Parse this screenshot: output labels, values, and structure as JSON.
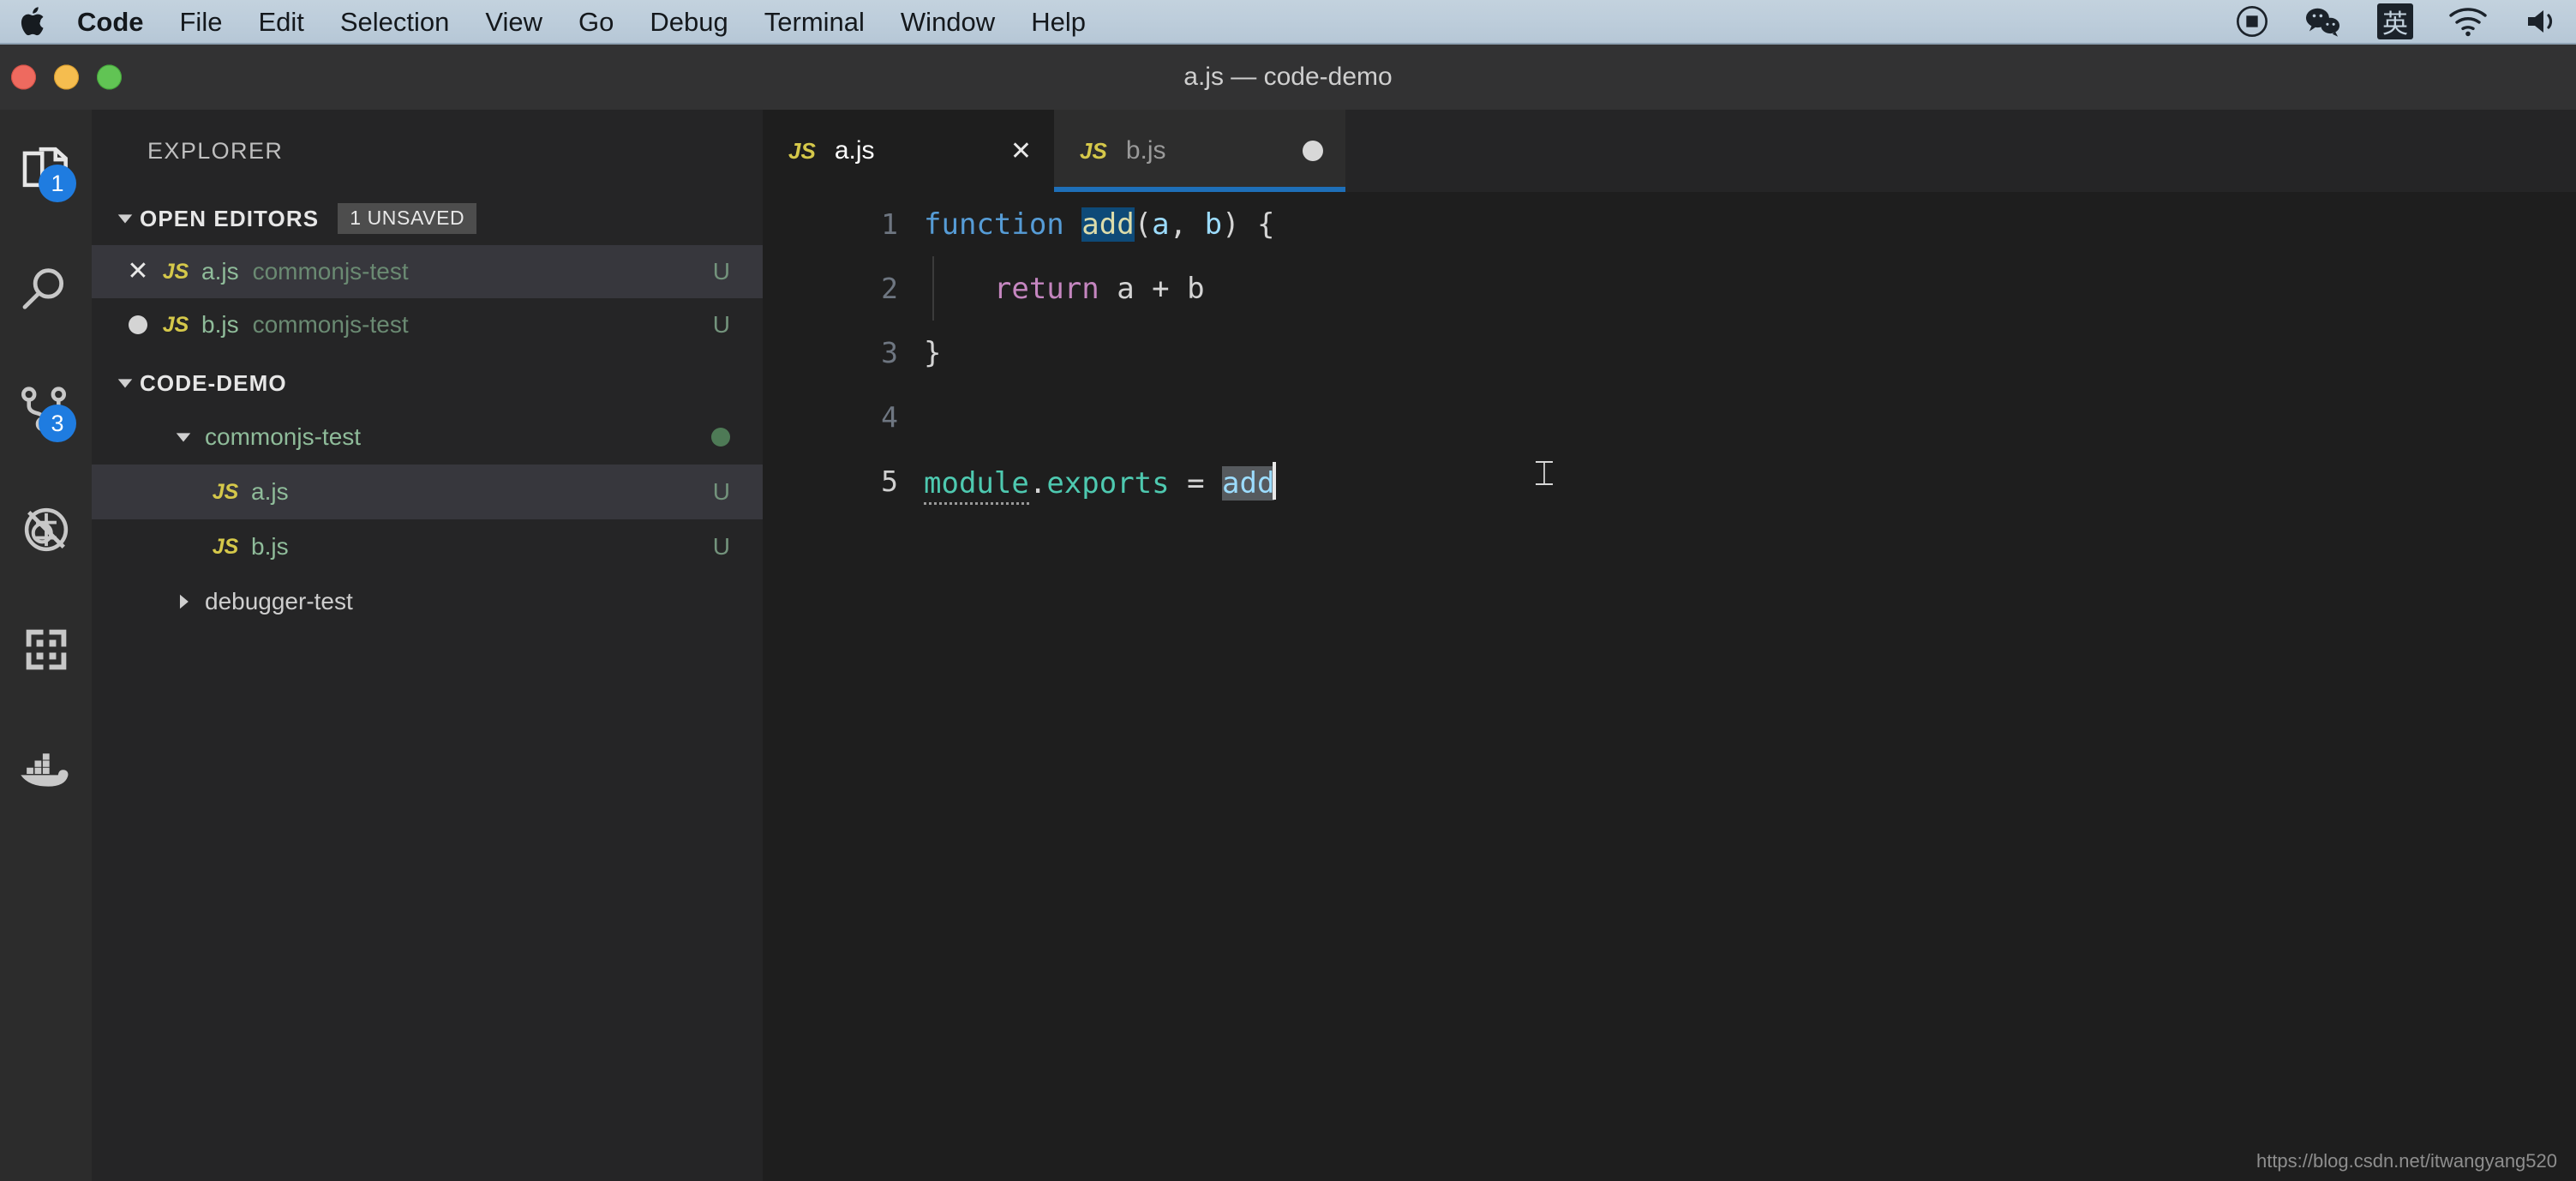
{
  "menubar": {
    "apple_icon": "apple-logo-icon",
    "items": [
      {
        "label": "Code",
        "bold": true
      },
      {
        "label": "File",
        "bold": false
      },
      {
        "label": "Edit",
        "bold": false
      },
      {
        "label": "Selection",
        "bold": false
      },
      {
        "label": "View",
        "bold": false
      },
      {
        "label": "Go",
        "bold": false
      },
      {
        "label": "Debug",
        "bold": false
      },
      {
        "label": "Terminal",
        "bold": false
      },
      {
        "label": "Window",
        "bold": false
      },
      {
        "label": "Help",
        "bold": false
      }
    ],
    "tray": [
      {
        "name": "screen-record-icon",
        "glyph": ""
      },
      {
        "name": "wechat-icon",
        "glyph": ""
      },
      {
        "name": "input-method-icon",
        "glyph": "英"
      },
      {
        "name": "wifi-icon",
        "glyph": ""
      },
      {
        "name": "volume-icon",
        "glyph": ""
      }
    ],
    "background": "#bdcddb"
  },
  "window": {
    "title": "a.js — code-demo",
    "traffic_lights": [
      "close",
      "minimize",
      "zoom"
    ]
  },
  "activitybar": {
    "items": [
      {
        "name": "explorer-icon",
        "badge": "1"
      },
      {
        "name": "search-icon",
        "badge": ""
      },
      {
        "name": "source-control-icon",
        "badge": "3"
      },
      {
        "name": "debug-icon",
        "badge": ""
      },
      {
        "name": "extensions-icon",
        "badge": ""
      },
      {
        "name": "docker-icon",
        "badge": ""
      }
    ],
    "badge_color": "#1f7ce0"
  },
  "sidebar": {
    "title": "EXPLORER",
    "open_editors": {
      "label": "OPEN EDITORS",
      "badge": "1 UNSAVED",
      "items": [
        {
          "action": "close",
          "name": "a.js",
          "description": "commonjs-test",
          "status": "U",
          "selected": true
        },
        {
          "action": "dirty",
          "name": "b.js",
          "description": "commonjs-test",
          "status": "U",
          "selected": false
        }
      ]
    },
    "folder": {
      "label": "CODE-DEMO",
      "tree": [
        {
          "type": "folder",
          "name": "commonjs-test",
          "expanded": true,
          "status": "",
          "dot": true,
          "selected": false,
          "indent": 1
        },
        {
          "type": "file",
          "name": "a.js",
          "status": "U",
          "selected": true,
          "indent": 2
        },
        {
          "type": "file",
          "name": "b.js",
          "status": "U",
          "selected": false,
          "indent": 2
        },
        {
          "type": "folder",
          "name": "debugger-test",
          "expanded": false,
          "status": "",
          "dot": false,
          "selected": false,
          "indent": 1
        }
      ]
    }
  },
  "editor": {
    "tabs": [
      {
        "label": "a.js",
        "icon": "JS",
        "active": true,
        "action": "×"
      },
      {
        "label": "b.js",
        "icon": "JS",
        "active": false,
        "action": "dirty-dot"
      }
    ],
    "lines": [
      {
        "number": "1",
        "active": false
      },
      {
        "number": "2",
        "active": false
      },
      {
        "number": "3",
        "active": false
      },
      {
        "number": "4",
        "active": false
      },
      {
        "number": "5",
        "active": true
      }
    ],
    "code": {
      "l1_kw": "function",
      "l1_space": " ",
      "l1_fn": "add",
      "l1_open": "(",
      "l1_p1": "a",
      "l1_comma": ", ",
      "l1_p2": "b",
      "l1_close": ") {",
      "l2_indent": "    ",
      "l2_kw": "return",
      "l2_rest": " a + b",
      "l3": "}",
      "l4": "",
      "l5_obj": "module",
      "l5_dot": ".",
      "l5_prop": "exports",
      "l5_eq": " = ",
      "l5_val": "add"
    },
    "language": "JavaScript"
  },
  "watermark": "https://blog.csdn.net/itwangyang520"
}
